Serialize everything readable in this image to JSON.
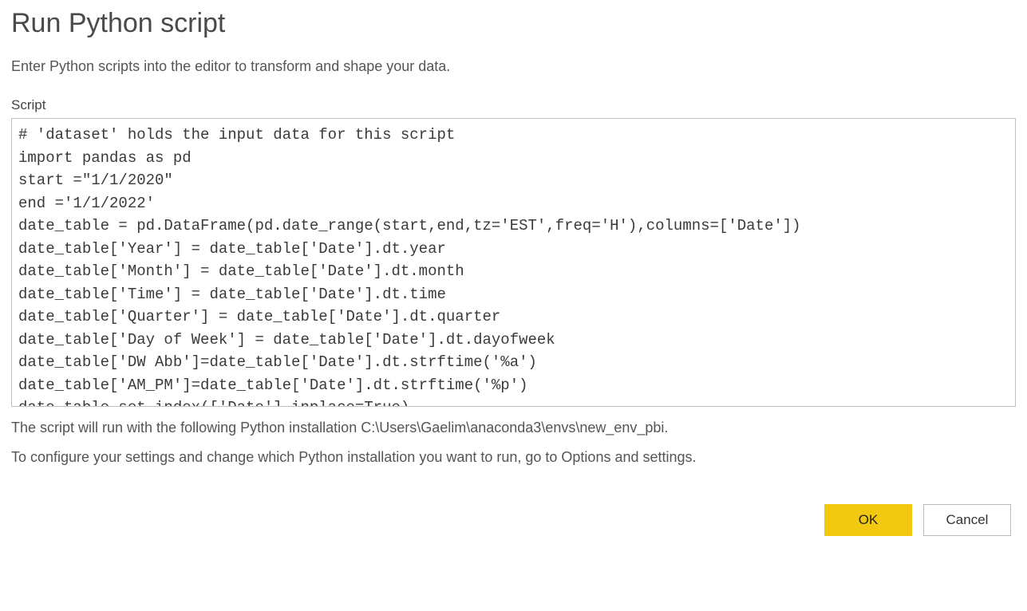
{
  "dialog": {
    "title": "Run Python script",
    "subtitle": "Enter Python scripts into the editor to transform and shape your data.",
    "script_label": "Script",
    "script_value": "# 'dataset' holds the input data for this script\nimport pandas as pd\nstart =\"1/1/2020\"\nend ='1/1/2022'\ndate_table = pd.DataFrame(pd.date_range(start,end,tz='EST',freq='H'),columns=['Date'])\ndate_table['Year'] = date_table['Date'].dt.year\ndate_table['Month'] = date_table['Date'].dt.month\ndate_table['Time'] = date_table['Date'].dt.time\ndate_table['Quarter'] = date_table['Date'].dt.quarter\ndate_table['Day of Week'] = date_table['Date'].dt.dayofweek\ndate_table['DW Abb']=date_table['Date'].dt.strftime('%a')\ndate_table['AM_PM']=date_table['Date'].dt.strftime('%p')\ndate_table.set_index(['Date'],inplace=True)",
    "install_info": "The script will run with the following Python installation C:\\Users\\Gaelim\\anaconda3\\envs\\new_env_pbi.",
    "configure_info": "To configure your settings and change which Python installation you want to run, go to Options and settings.",
    "ok_label": "OK",
    "cancel_label": "Cancel"
  }
}
